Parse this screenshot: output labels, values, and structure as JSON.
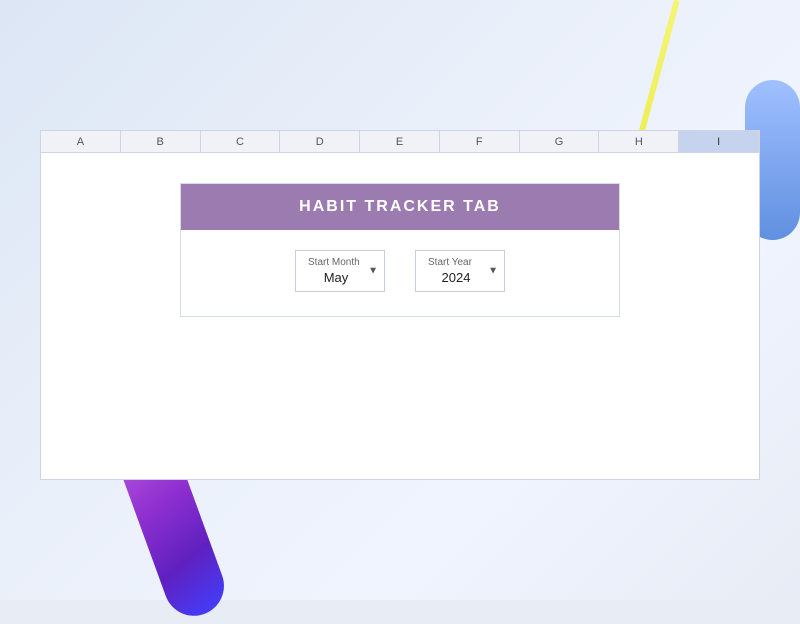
{
  "background": {
    "color": "#dce6f5"
  },
  "spreadsheet": {
    "columns": [
      {
        "id": "A",
        "label": "A",
        "selected": false
      },
      {
        "id": "B",
        "label": "B",
        "selected": false
      },
      {
        "id": "C",
        "label": "C",
        "selected": false
      },
      {
        "id": "D",
        "label": "D",
        "selected": false
      },
      {
        "id": "E",
        "label": "E",
        "selected": false
      },
      {
        "id": "F",
        "label": "F",
        "selected": false
      },
      {
        "id": "G",
        "label": "G",
        "selected": false
      },
      {
        "id": "H",
        "label": "H",
        "selected": false
      },
      {
        "id": "I",
        "label": "I",
        "selected": true
      }
    ]
  },
  "tracker": {
    "title": "HABIT TRACKER TAB",
    "start_month": {
      "label": "Start Month",
      "value": "May"
    },
    "start_year": {
      "label": "Start Year",
      "value": "2024"
    }
  }
}
